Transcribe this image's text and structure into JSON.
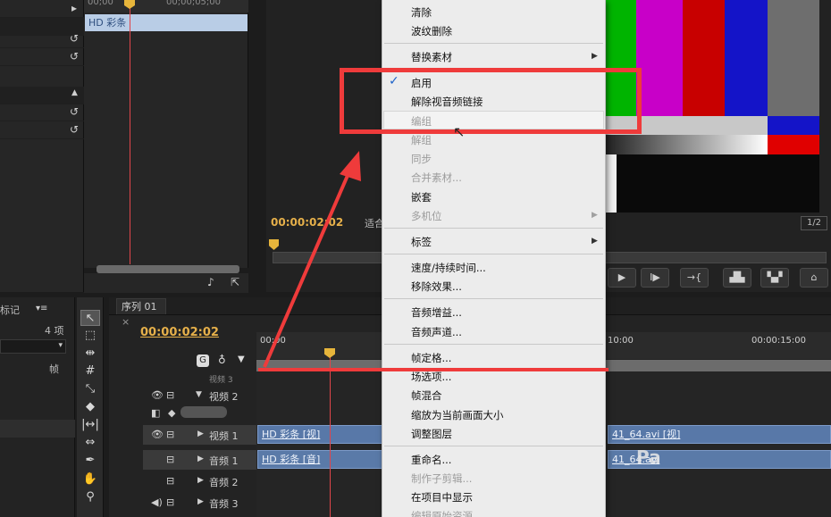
{
  "source_panel": {
    "ruler_labels": [
      "00;00",
      "00;00;05;00"
    ],
    "clip_label": "HD 彩条"
  },
  "monitor": {
    "timecode": "00:00:02:02",
    "fit_label": "适合",
    "page_label": "1/2",
    "color_bars_top": [
      "#00b400",
      "#c800c8",
      "#c80000",
      "#1414c8",
      "#6e6e6e"
    ],
    "color_bars_mid": [
      "#c8c8c8",
      "#c8c8c8",
      "#c8c8c8",
      "#c8c8c8",
      "#1414c8"
    ]
  },
  "project": {
    "tab_label": "标记",
    "item_count": "4 项",
    "frame_label": "帧"
  },
  "sequence": {
    "tab_label": "序列 01",
    "timecode": "00:00:02:02",
    "ruler_ticks": [
      "00:00",
      "10:00",
      "00:00:15:00"
    ],
    "tracks": {
      "video2": "视频 2",
      "video1": "视频 1",
      "audio1": "音频 1",
      "audio2": "音频 2",
      "audio3": "音频 3",
      "video3": "视频 3"
    },
    "clips": {
      "video1_left": "HD 彩条 [视]",
      "audio1_left": "HD 彩条 [音]",
      "video1_right": "41_64.avi [视]",
      "audio1_right": "41_64.avi"
    }
  },
  "context_menu": {
    "items": {
      "clear": "清除",
      "ripple_delete": "波纹删除",
      "replace_footage": "替换素材",
      "enable": "启用",
      "unlink": "解除视音频链接",
      "group": "编组",
      "ungroup": "解组",
      "sync": "同步",
      "merge_clips": "合并素材...",
      "nest": "嵌套",
      "multicam": "多机位",
      "label": "标签",
      "speed_duration": "速度/持续时间...",
      "remove_effects": "移除效果...",
      "audio_gain": "音频增益...",
      "audio_channels": "音频声道...",
      "frame_hold": "帧定格...",
      "field_options": "场选项...",
      "frame_blend": "帧混合",
      "scale_to_frame": "缩放为当前画面大小",
      "adjustment_layer": "调整图层",
      "rename": "重命名...",
      "make_subclip": "制作子剪辑...",
      "reveal_in_project": "在项目中显示",
      "edit_original": "编辑原始资源"
    },
    "enabled_checked": true
  },
  "watermark": "Pa"
}
